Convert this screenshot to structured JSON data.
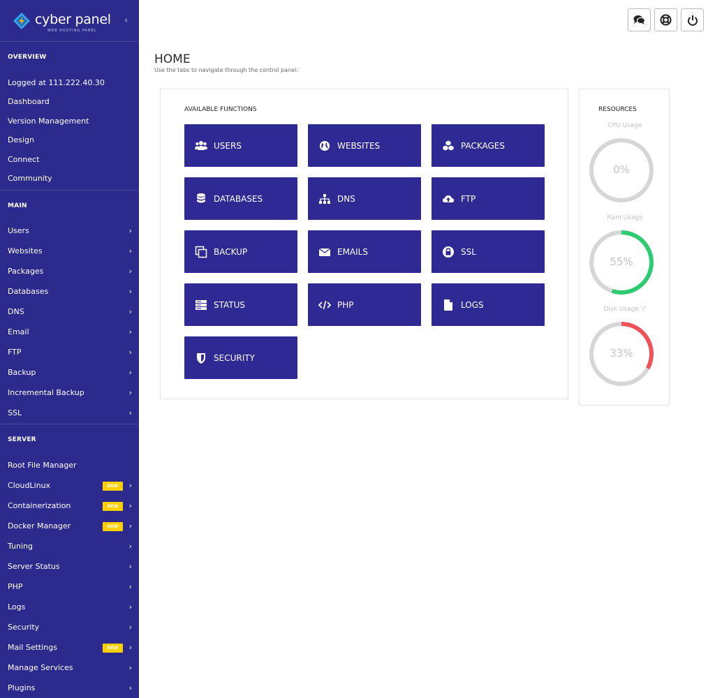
{
  "brand": {
    "name": "cyber panel",
    "tagline": "WEB HOSTING PANEL",
    "collapse": "‹"
  },
  "sidebar": {
    "overview": {
      "title": "OVERVIEW",
      "items": [
        "Logged at 111.222.40.30",
        "Dashboard",
        "Version Management",
        "Design",
        "Connect",
        "Community"
      ]
    },
    "main": {
      "title": "MAIN",
      "items": [
        "Users",
        "Websites",
        "Packages",
        "Databases",
        "DNS",
        "Email",
        "FTP",
        "Backup",
        "Incremental Backup",
        "SSL"
      ]
    },
    "server": {
      "title": "SERVER",
      "items": [
        {
          "label": "Root File Manager",
          "badge": "",
          "chevron": false
        },
        {
          "label": "CloudLinux",
          "badge": "NEW",
          "chevron": true
        },
        {
          "label": "Containerization",
          "badge": "NEW",
          "chevron": true
        },
        {
          "label": "Docker Manager",
          "badge": "NEW",
          "chevron": true
        },
        {
          "label": "Tuning",
          "badge": "",
          "chevron": true
        },
        {
          "label": "Server Status",
          "badge": "",
          "chevron": true
        },
        {
          "label": "PHP",
          "badge": "",
          "chevron": true
        },
        {
          "label": "Logs",
          "badge": "",
          "chevron": true
        },
        {
          "label": "Security",
          "badge": "",
          "chevron": true
        },
        {
          "label": "Mail Settings",
          "badge": "NEW",
          "chevron": true
        },
        {
          "label": "Manage Services",
          "badge": "",
          "chevron": true
        },
        {
          "label": "Plugins",
          "badge": "",
          "chevron": true
        }
      ]
    },
    "chevron": "›"
  },
  "topbar": {
    "icons": [
      "chat-icon",
      "lifebuoy-icon",
      "power-icon"
    ]
  },
  "page": {
    "title": "HOME",
    "subtitle": "Use the tabs to navigate through the control panel."
  },
  "functions": {
    "title": "AVAILABLE FUNCTIONS",
    "items": [
      {
        "label": "USERS",
        "icon": "users-icon"
      },
      {
        "label": "WEBSITES",
        "icon": "globe-icon"
      },
      {
        "label": "PACKAGES",
        "icon": "cubes-icon"
      },
      {
        "label": "DATABASES",
        "icon": "database-icon"
      },
      {
        "label": "DNS",
        "icon": "sitemap-icon"
      },
      {
        "label": "FTP",
        "icon": "cloud-upload-icon"
      },
      {
        "label": "BACKUP",
        "icon": "copy-icon"
      },
      {
        "label": "EMAILS",
        "icon": "envelope-icon"
      },
      {
        "label": "SSL",
        "icon": "lock-icon"
      },
      {
        "label": "STATUS",
        "icon": "server-icon"
      },
      {
        "label": "PHP",
        "icon": "code-icon"
      },
      {
        "label": "LOGS",
        "icon": "file-icon"
      },
      {
        "label": "SECURITY",
        "icon": "shield-icon"
      }
    ]
  },
  "resources": {
    "title": "RESOURCES",
    "gauges": [
      {
        "label": "CPU Usage",
        "value": "0%",
        "percent": 0,
        "color": "#2ecc71"
      },
      {
        "label": "Ram Usage",
        "value": "55%",
        "percent": 55,
        "color": "#2ecc71"
      },
      {
        "label": "Disk Usage '/'",
        "value": "33%",
        "percent": 33,
        "color": "#f0525a"
      }
    ],
    "track_color": "#d6d6d6"
  },
  "colors": {
    "sidebar": "#2d2a8d",
    "button": "#2f2a93",
    "badge": "#ffd000"
  }
}
